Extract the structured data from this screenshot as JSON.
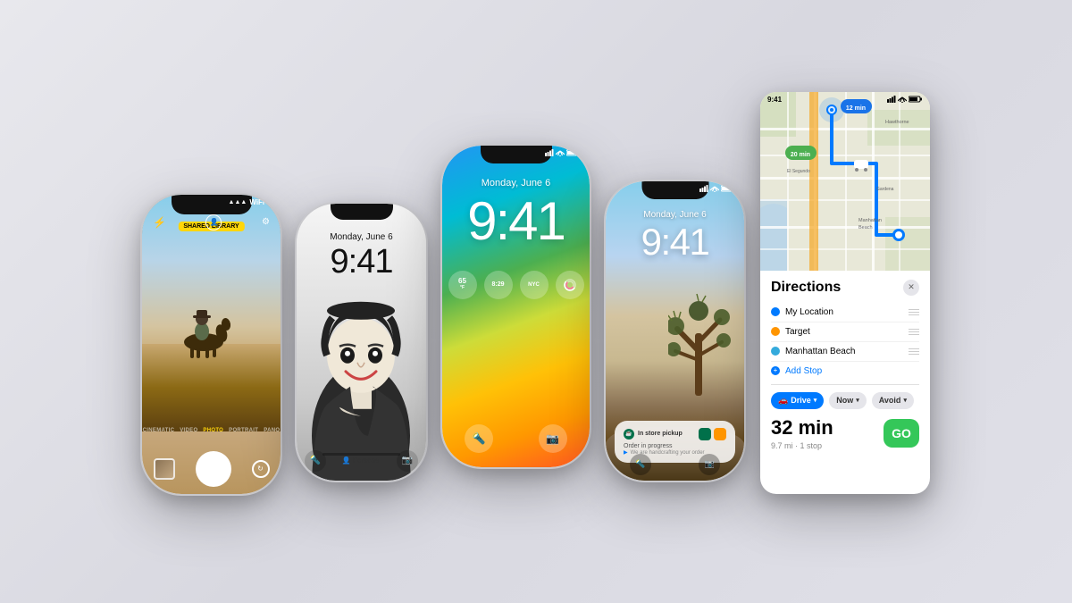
{
  "phones": {
    "phone1": {
      "shared_library": "SHARED LIBRARY",
      "modes": [
        "CINEMATIC",
        "VIDEO",
        "PHOTO",
        "PORTRAIT",
        "PANO"
      ],
      "active_mode": "PHOTO"
    },
    "phone2": {
      "date": "Monday, June 6",
      "time": "9:41",
      "personal_label": "Personal",
      "camera_label": ""
    },
    "phone3": {
      "date": "Monday, June 6",
      "time": "9:41",
      "widget1": "65",
      "widget2": "8:29",
      "widget3": "NYC"
    },
    "phone4": {
      "date": "Monday, June 6",
      "time": "9:41",
      "notif_store": "In store pickup",
      "notif_order": "Order in progress",
      "notif_sub": "We are handcrafting your order"
    }
  },
  "maps": {
    "title": "Directions",
    "stops": [
      {
        "name": "My Location",
        "dot_color": "blue"
      },
      {
        "name": "Target",
        "dot_color": "orange"
      },
      {
        "name": "Manhattan Beach",
        "dot_color": "blue2"
      }
    ],
    "add_stop": "Add Stop",
    "options": {
      "drive": "Drive",
      "now": "Now",
      "avoid": "Avoid"
    },
    "route_time": "32 min",
    "route_distance": "9.7 mi · 1 stop",
    "go_label": "GO",
    "map_badge_1": "12 min",
    "map_badge_2": "20 min"
  },
  "status_bar": {
    "time": "9:41"
  }
}
